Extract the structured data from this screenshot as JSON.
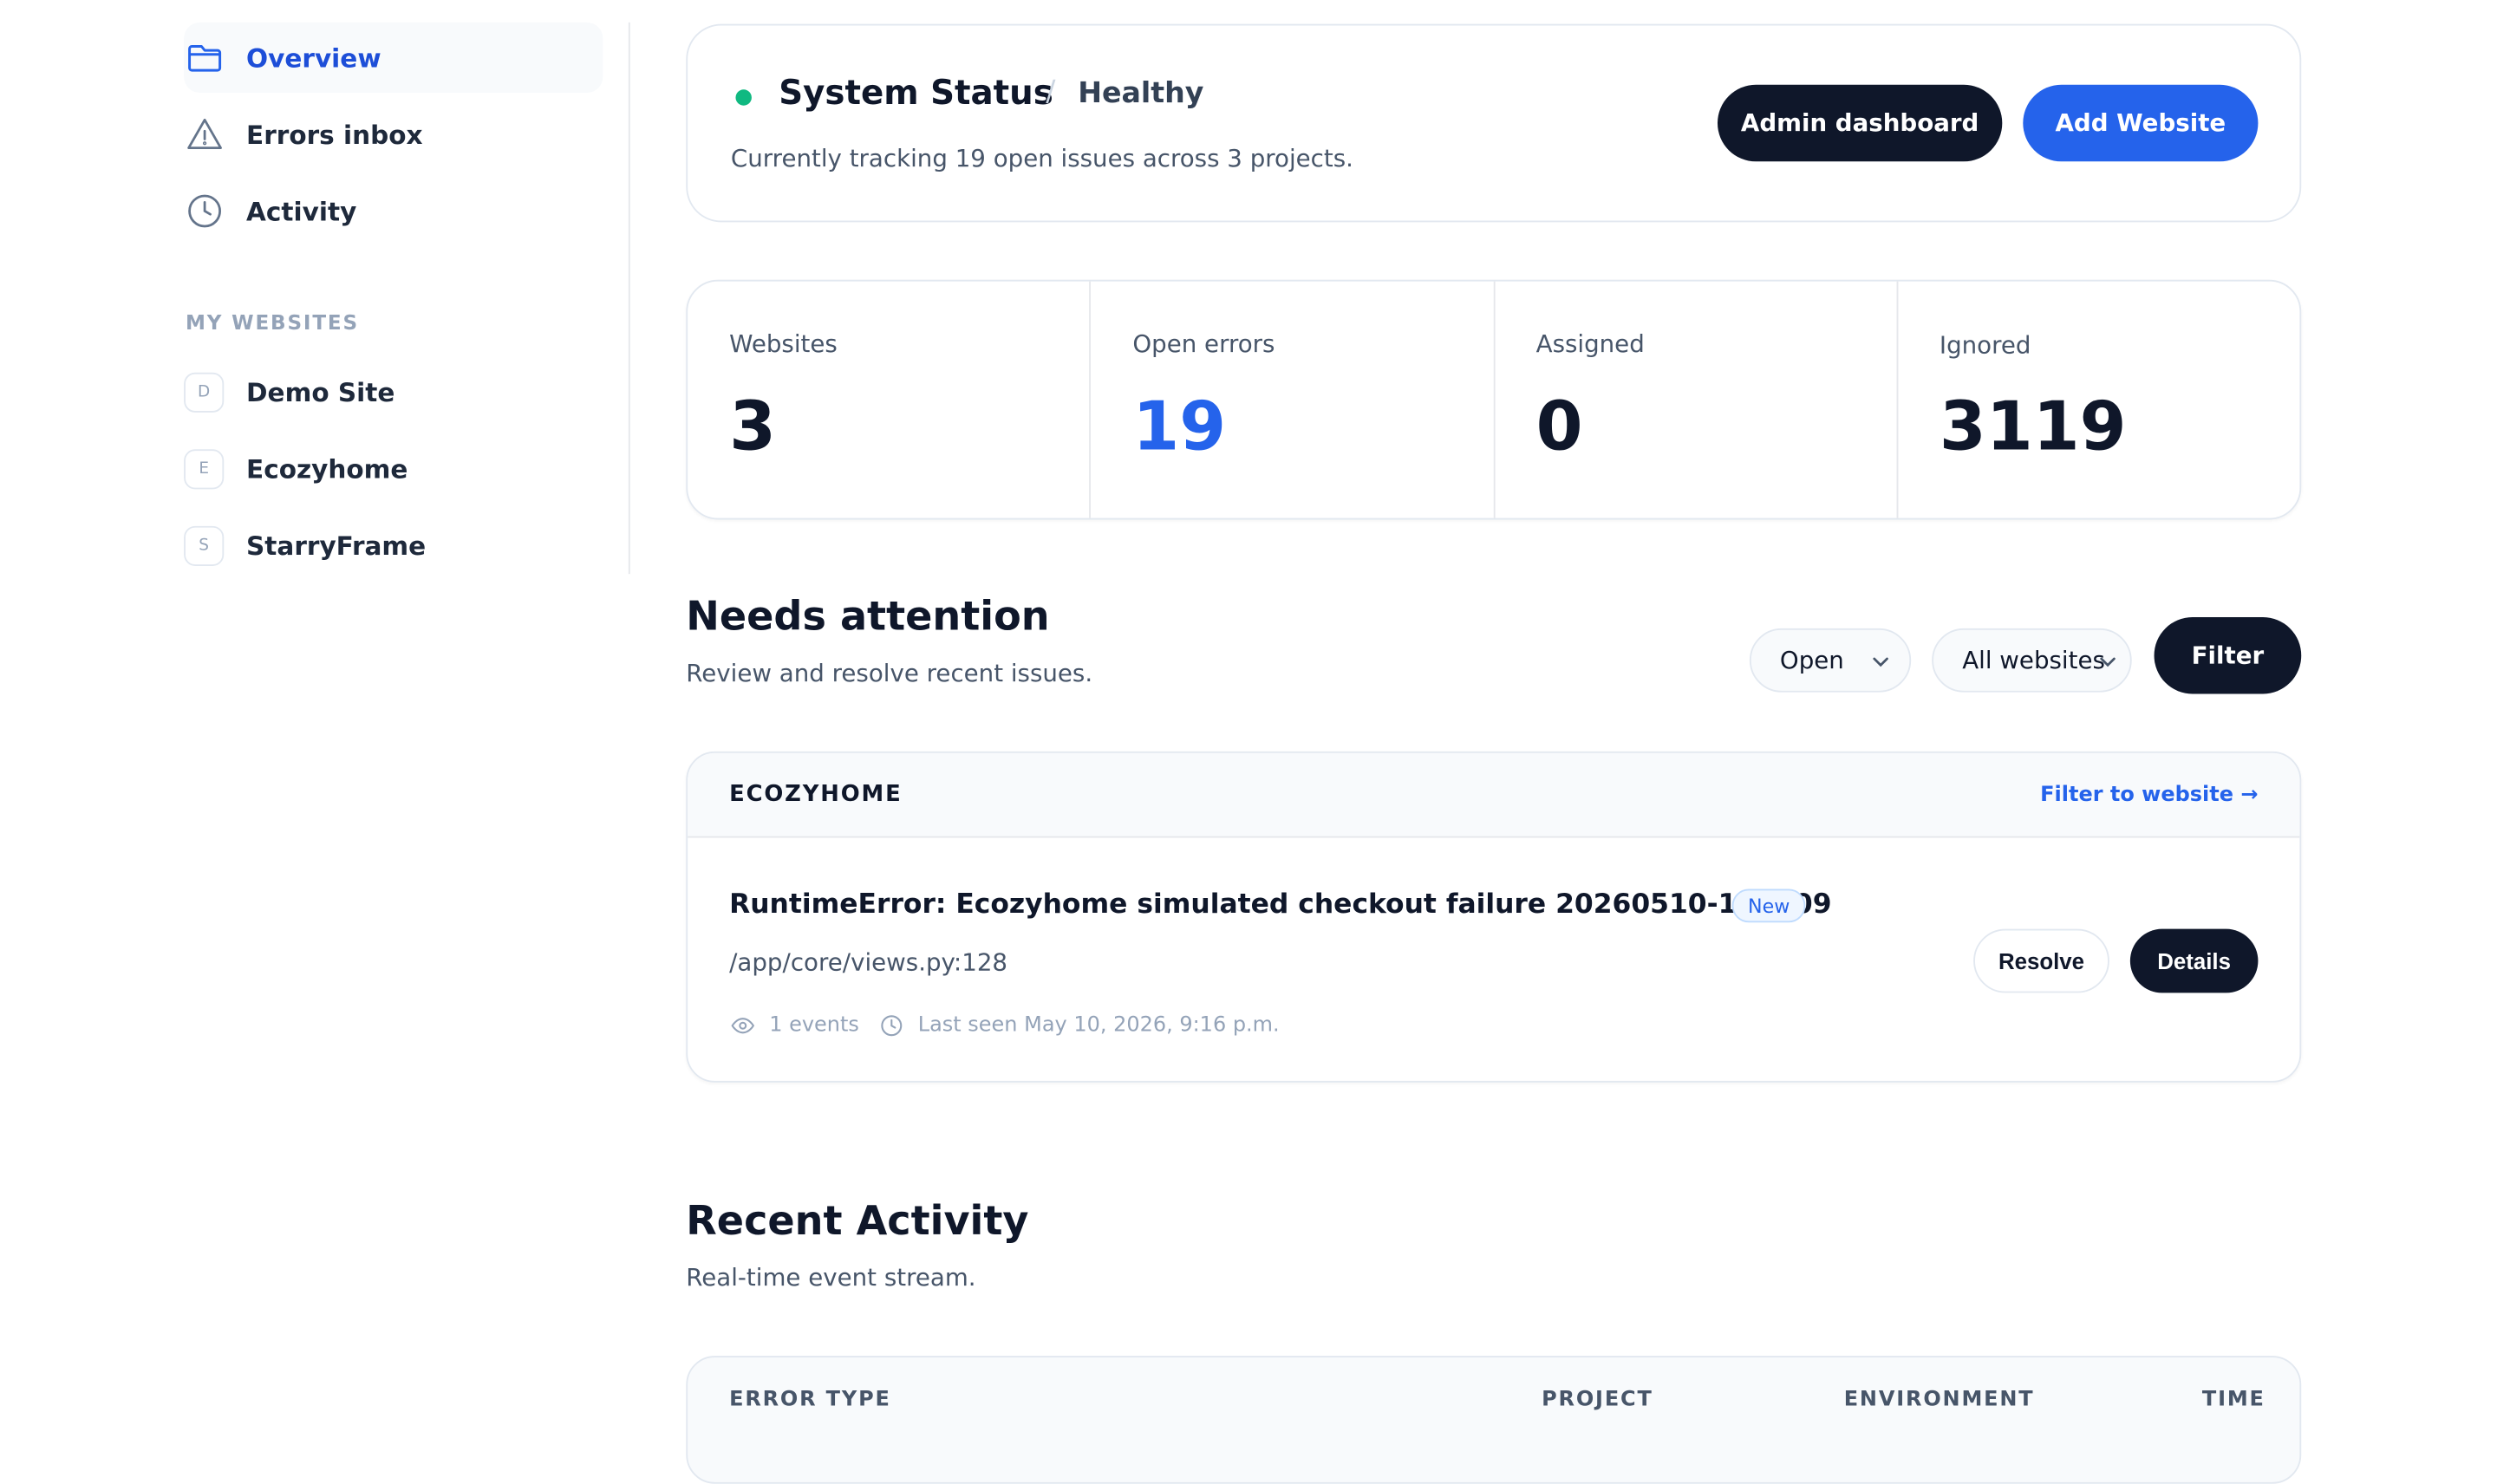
{
  "sidebar": {
    "nav": [
      {
        "label": "Overview",
        "icon": "folder-icon",
        "active": true
      },
      {
        "label": "Errors inbox",
        "icon": "warning-icon"
      },
      {
        "label": "Activity",
        "icon": "clock-icon"
      }
    ],
    "section_label": "MY WEBSITES",
    "sites": [
      {
        "initial": "D",
        "label": "Demo Site"
      },
      {
        "initial": "E",
        "label": "Ecozyhome"
      },
      {
        "initial": "S",
        "label": "StarryFrame"
      }
    ]
  },
  "status": {
    "title": "System Status",
    "separator": "/",
    "health": "Healthy",
    "subtitle": "Currently tracking 19 open issues across 3 projects.",
    "admin_button": "Admin dashboard",
    "add_button": "Add Website",
    "dot_color": "#10b981"
  },
  "stats": [
    {
      "label": "Websites",
      "value": "3"
    },
    {
      "label": "Open errors",
      "value": "19"
    },
    {
      "label": "Assigned",
      "value": "0"
    },
    {
      "label": "Ignored",
      "value": "3119"
    }
  ],
  "attention": {
    "title": "Needs attention",
    "subtitle": "Review and resolve recent issues.",
    "status_select": "Open",
    "website_select": "All websites",
    "filter_button": "Filter"
  },
  "issue_group": {
    "site": "ECOZYHOME",
    "filter_link": "Filter to website →",
    "issue": {
      "title": "RuntimeError: Ecozyhome simulated checkout failure 20260510-191609",
      "tag": "New",
      "path": "/app/core/views.py:128",
      "events": "1 events",
      "last_seen": "Last seen May 10, 2026, 9:16 p.m.",
      "resolve_button": "Resolve",
      "details_button": "Details"
    }
  },
  "activity": {
    "title": "Recent Activity",
    "subtitle": "Real-time event stream.",
    "columns": [
      "ERROR TYPE",
      "PROJECT",
      "ENVIRONMENT",
      "TIME"
    ]
  },
  "colors": {
    "accent": "#2563eb",
    "dark": "#0f172a",
    "success": "#10b981"
  }
}
